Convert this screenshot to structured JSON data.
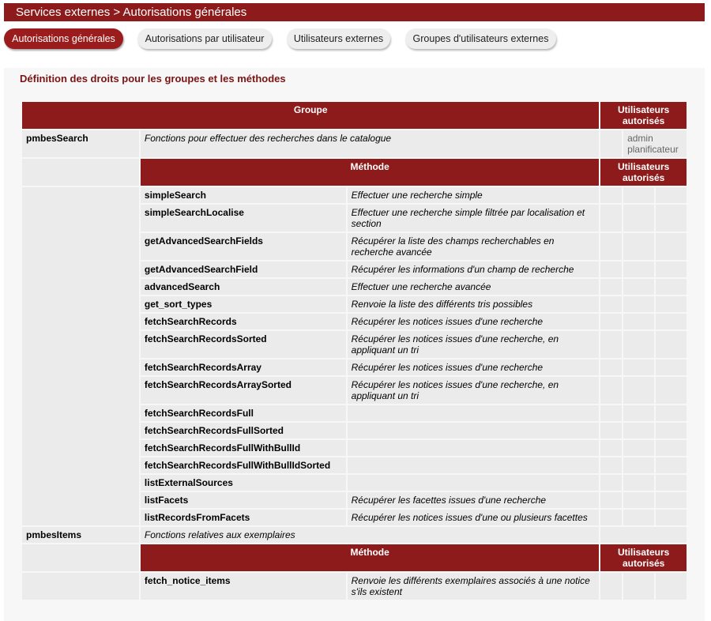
{
  "breadcrumb": "Services externes > Autorisations générales",
  "tabs": [
    {
      "label": "Autorisations générales",
      "active": true
    },
    {
      "label": "Autorisations par utilisateur",
      "active": false
    },
    {
      "label": "Utilisateurs externes",
      "active": false
    },
    {
      "label": "Groupes d'utilisateurs externes",
      "active": false
    }
  ],
  "section_title": "Définition des droits pour les groupes et les méthodes",
  "table": {
    "group_header": "Groupe",
    "users_header": "Utilisateurs autorisés",
    "method_header": "Méthode",
    "groups": [
      {
        "name": "pmbesSearch",
        "description": "Fonctions pour effectuer des recherches dans le catalogue",
        "users": [
          "admin",
          "planificateur"
        ],
        "methods": [
          {
            "name": "simpleSearch",
            "desc": "Effectuer une recherche simple"
          },
          {
            "name": "simpleSearchLocalise",
            "desc": "Effectuer une recherche simple filtrée par localisation et section"
          },
          {
            "name": "getAdvancedSearchFields",
            "desc": "Récupérer la liste des champs recherchables en recherche avancée"
          },
          {
            "name": "getAdvancedSearchField",
            "desc": "Récupérer les informations d'un champ de recherche"
          },
          {
            "name": "advancedSearch",
            "desc": "Effectuer une recherche avancée"
          },
          {
            "name": "get_sort_types",
            "desc": "Renvoie la liste des différents tris possibles"
          },
          {
            "name": "fetchSearchRecords",
            "desc": "Récupérer les notices issues d'une recherche"
          },
          {
            "name": "fetchSearchRecordsSorted",
            "desc": "Récupérer les notices issues d'une recherche, en appliquant un tri"
          },
          {
            "name": "fetchSearchRecordsArray",
            "desc": "Récupérer les notices issues d'une recherche"
          },
          {
            "name": "fetchSearchRecordsArraySorted",
            "desc": "Récupérer les notices issues d'une recherche, en appliquant un tri"
          },
          {
            "name": "fetchSearchRecordsFull",
            "desc": ""
          },
          {
            "name": "fetchSearchRecordsFullSorted",
            "desc": ""
          },
          {
            "name": "fetchSearchRecordsFullWithBullId",
            "desc": ""
          },
          {
            "name": "fetchSearchRecordsFullWithBullIdSorted",
            "desc": ""
          },
          {
            "name": "listExternalSources",
            "desc": ""
          },
          {
            "name": "listFacets",
            "desc": "Récupérer les facettes issues d'une recherche"
          },
          {
            "name": "listRecordsFromFacets",
            "desc": "Récupérer les notices issues d'une ou plusieurs facettes"
          }
        ]
      },
      {
        "name": "pmbesItems",
        "description": "Fonctions relatives aux exemplaires",
        "users": [],
        "methods": [
          {
            "name": "fetch_notice_items",
            "desc": "Renvoie les différents exemplaires associés à une notice s'ils existent"
          }
        ]
      }
    ]
  }
}
